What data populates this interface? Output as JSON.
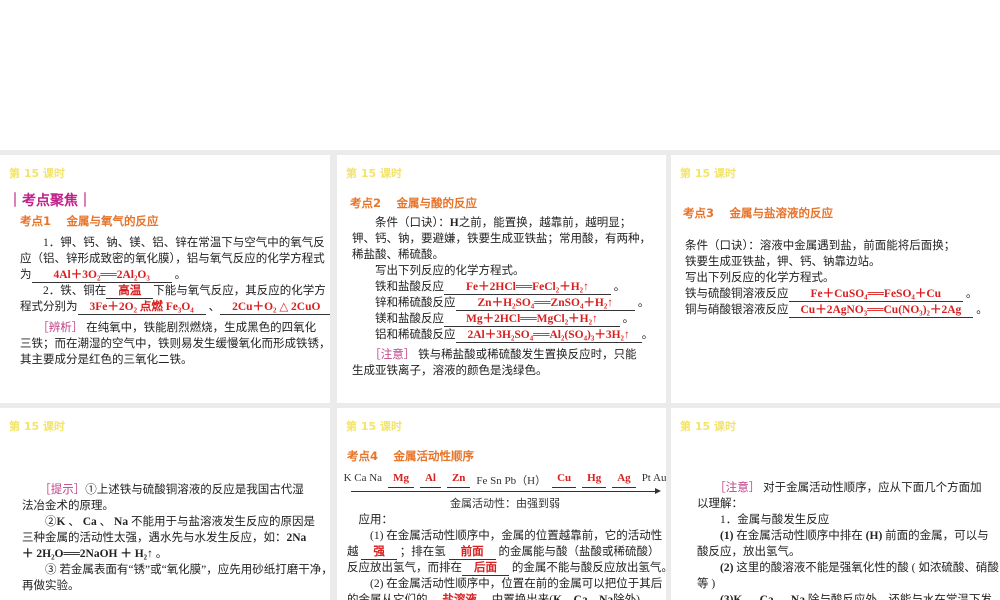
{
  "lesson_title": "第 15 课时",
  "focus_heading": "｜考点聚焦｜",
  "colors": {
    "title": "#f3e46a",
    "focus": "#c0208a",
    "heading": "#e8742a",
    "answer": "#d92020",
    "tag": "#c0408a"
  },
  "card1": {
    "heading": "考点1　 金属与氧气的反应",
    "p1": [
      [
        "　　1．钾、钙、钠、镁、铝、锌在常温下与空气中的氧气反"
      ],
      [
        "应（铝、锌形成致密的氧化膜），铝与氧气反应的化学方程式"
      ],
      [
        "为",
        {
          "aw": "4Al＋3O₂══2Al₂O₃"
        },
        " 。"
      ],
      [
        "　　2．铁、铜在",
        {
          "a": "高温"
        },
        "下能与氧气反应，其反应的化学方"
      ],
      [
        "程式分别为",
        {
          "a": "3Fe＋2O₂ 点燃 Fe₃O₄"
        },
        " 、",
        {
          "a": "2Cu＋O₂ △ 2CuO"
        },
        " 。"
      ]
    ],
    "p2": [
      [
        "　　",
        {
          "tag": "［辨析］"
        },
        " 在纯氧中，铁能剧烈燃烧，生成黑色的四氧化"
      ],
      [
        "三铁；而在潮湿的空气中，铁则易发生缓慢氧化而形成铁锈，"
      ],
      [
        "其主要成分是红色的三氧化二铁。"
      ]
    ]
  },
  "card2": {
    "heading": "考点2　 金属与酸的反应",
    "p1": [
      [
        "　　条件（口诀）：",
        {
          "b": "H"
        },
        "之前，能置换，越靠前，越明显；"
      ],
      [
        "钾、钙、钠，要避嫌，铁要生成亚铁盐；常用酸，有两种，"
      ],
      [
        "稀盐酸、稀硫酸。"
      ],
      [
        "　　写出下列反应的化学方程式。"
      ],
      [
        "　　铁和盐酸反应",
        {
          "aw": "Fe＋2HCl══FeCl₂＋H₂↑"
        },
        " 。"
      ],
      [
        "　　锌和稀硫酸反应",
        {
          "aw": "Zn＋H₂SO₄══ZnSO₄＋H₂↑"
        },
        " 。"
      ],
      [
        "　　镁和盐酸反应",
        {
          "aw": "Mg＋2HCl══MgCl₂＋H₂↑"
        },
        " 。"
      ],
      [
        "　　铝和稀硫酸反应",
        {
          "a": "2Al＋3H₂SO₄══Al₂(SO₄)₃＋3H₂↑"
        },
        "。"
      ]
    ],
    "p2": [
      [
        "　　",
        {
          "tag": "［注意］"
        },
        " 铁与稀盐酸或稀硫酸发生置换反应时，只能"
      ],
      [
        "生成亚铁离子，溶液的颜色是浅绿色。"
      ]
    ]
  },
  "card3": {
    "heading": "考点3　 金属与盐溶液的反应",
    "p1": [
      [
        "条件（口诀）：溶液中金属遇到盐，前面能将后面换；"
      ],
      [
        "铁要生成亚铁盐，钾、钙、钠靠边站。"
      ],
      [
        "写出下列反应的化学方程式。"
      ],
      [
        "铁与硫酸铜溶液反应",
        {
          "aw": "Fe＋CuSO₄══FeSO₄＋Cu"
        },
        " 。"
      ],
      [
        "铜与硝酸银溶液反应",
        {
          "a": "Cu＋2AgNO₃══Cu(NO₃)₂＋2Ag"
        },
        " 。"
      ]
    ]
  },
  "card4": {
    "p1": [
      [
        "　　",
        {
          "tag": "［提示］"
        },
        "①上述铁与硫酸铜溶液的反应是我国古代湿"
      ],
      [
        "法冶金术的原理。"
      ],
      [
        "　　②",
        {
          "b": "K"
        },
        " 、 ",
        {
          "b": "Ca"
        },
        " 、 ",
        {
          "b": "Na"
        },
        " 不能用于与盐溶液发生反应的原因是"
      ],
      [
        "三种金属的活动性太强，遇水先与水发生反应，如：",
        {
          "b": "2Na"
        }
      ],
      [
        {
          "b": "＋ 2H₂O══2NaOH ＋ H₂"
        },
        "↑ 。"
      ],
      [
        "　　③ 若金属表面有“锈”或“氧化膜”，应先用砂纸打磨干净，"
      ],
      [
        "再做实验。"
      ]
    ]
  },
  "card5": {
    "heading": "考点4　 金属活动性顺序",
    "series": [
      {
        "t": "K Ca Na"
      },
      {
        "m": "Mg"
      },
      {
        "m": "Al"
      },
      {
        "m": "Zn"
      },
      {
        "t": "Fe Sn Pb（H）"
      },
      {
        "m": "Cu"
      },
      {
        "m": "Hg"
      },
      {
        "m": "Ag"
      },
      {
        "t": "Pt Au"
      }
    ],
    "series_caption": "金属活动性：由强到弱",
    "p1": [
      [
        "　应用："
      ],
      [
        "　　(1) 在金属活动性顺序中，金属的位置越靠前，它的活动性"
      ],
      [
        "越 ",
        {
          "a": "强"
        },
        " ；排在氢 ",
        {
          "a": "前面"
        },
        " 的金属能与酸（盐酸或稀硫酸）"
      ],
      [
        "反应放出氢气，而排在",
        {
          "a": "后面"
        },
        " 的金属不能与酸反应放出氢气。"
      ],
      [
        "　　(2) 在金属活动性顺序中，位置在前的金属可以把位于其后"
      ],
      [
        "的金属从它们的 ",
        {
          "a": "盐溶液"
        },
        " 中置换出来(",
        {
          "b": "K"
        },
        "、",
        {
          "b": "Ca"
        },
        "、",
        {
          "b": "Na"
        },
        "除外)。"
      ]
    ]
  },
  "card6": {
    "p1": [
      [
        "　　",
        {
          "tag": "［注意］"
        },
        " 对于金属活动性顺序，应从下面几个方面加"
      ],
      [
        "以理解："
      ],
      [
        "　　1．金属与酸发生反应"
      ],
      [
        "　　",
        {
          "b": "(1)"
        },
        " 在金属活动性顺序中排在 ",
        {
          "b": "(H)"
        },
        " 前面的金属，可以与"
      ],
      [
        "酸反应，放出氢气。"
      ],
      [
        "　　",
        {
          "b": "(2)"
        },
        " 这里的酸溶液不能是强氧化性的酸 ( 如浓硫酸、硝酸"
      ],
      [
        "等 )"
      ],
      [
        "　　",
        {
          "b": "(3)K"
        },
        " 、 ",
        {
          "b": "Ca"
        },
        " 、 ",
        {
          "b": "Na"
        },
        " 除与酸反应外，还能与水在常温下发"
      ]
    ]
  }
}
